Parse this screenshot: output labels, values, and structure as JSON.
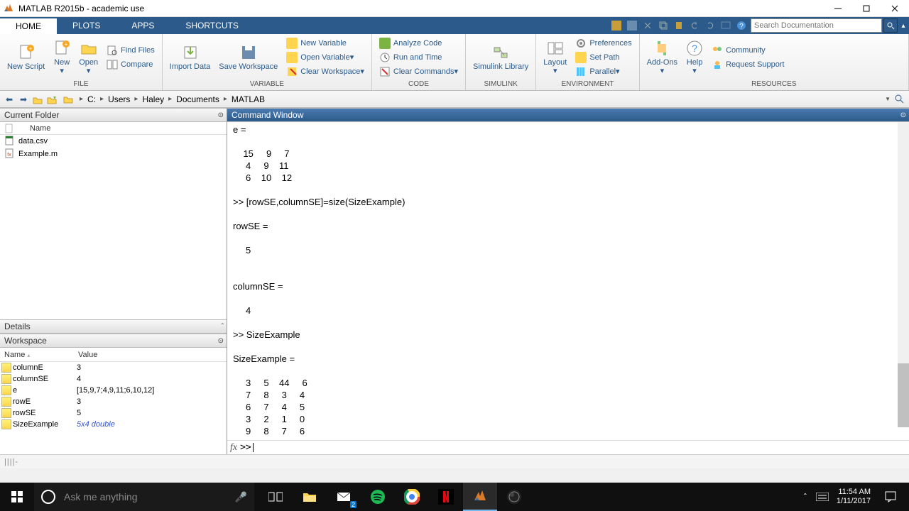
{
  "titlebar": {
    "text": "MATLAB R2015b - academic use"
  },
  "tabs": {
    "home": "HOME",
    "plots": "PLOTS",
    "apps": "APPS",
    "shortcuts": "SHORTCUTS"
  },
  "search": {
    "placeholder": "Search Documentation"
  },
  "toolstrip": {
    "new_script": "New\nScript",
    "new": "New",
    "open": "Open",
    "find_files": "Find Files",
    "compare": "Compare",
    "import_data": "Import\nData",
    "save_ws": "Save\nWorkspace",
    "new_var": "New Variable",
    "open_var": "Open Variable",
    "clear_ws": "Clear Workspace",
    "analyze": "Analyze Code",
    "run_time": "Run and Time",
    "clear_cmd": "Clear Commands",
    "simulink": "Simulink\nLibrary",
    "layout": "Layout",
    "prefs": "Preferences",
    "set_path": "Set Path",
    "parallel": "Parallel",
    "addons": "Add-Ons",
    "help": "Help",
    "community": "Community",
    "support": "Request Support",
    "groups": {
      "file": "FILE",
      "variable": "VARIABLE",
      "code": "CODE",
      "simulink": "SIMULINK",
      "environment": "ENVIRONMENT",
      "resources": "RESOURCES"
    }
  },
  "breadcrumb": [
    "C:",
    "Users",
    "Haley",
    "Documents",
    "MATLAB"
  ],
  "panels": {
    "current_folder": "Current Folder",
    "command_window": "Command Window",
    "details": "Details",
    "workspace": "Workspace"
  },
  "cf_header": {
    "name": "Name"
  },
  "files": [
    {
      "name": "data.csv"
    },
    {
      "name": "Example.m"
    }
  ],
  "ws_header": {
    "name": "Name",
    "value": "Value"
  },
  "workspace_vars": [
    {
      "name": "columnE",
      "value": "3"
    },
    {
      "name": "columnSE",
      "value": "4"
    },
    {
      "name": "e",
      "value": "[15,9,7;4,9,11;6,10,12]"
    },
    {
      "name": "rowE",
      "value": "3"
    },
    {
      "name": "rowSE",
      "value": "5"
    },
    {
      "name": "SizeExample",
      "value": "5x4 double",
      "link": true
    }
  ],
  "command_output": "e =\n\n    15     9     7\n     4     9    11\n     6    10    12\n\n>> [rowSE,columnSE]=size(SizeExample)\n\nrowSE =\n\n     5\n\n\ncolumnSE =\n\n     4\n\n>> SizeExample\n\nSizeExample =\n\n     3     5    44     6\n     7     8     3     4\n     6     7     4     5\n     3     2     1     0\n     9     8     7     6\n",
  "prompt": ">>",
  "statusbar": {
    "text": "||||-"
  },
  "cortana": "Ask me anything",
  "clock": {
    "time": "11:54 AM",
    "date": "1/11/2017"
  },
  "mail_badge": "2"
}
